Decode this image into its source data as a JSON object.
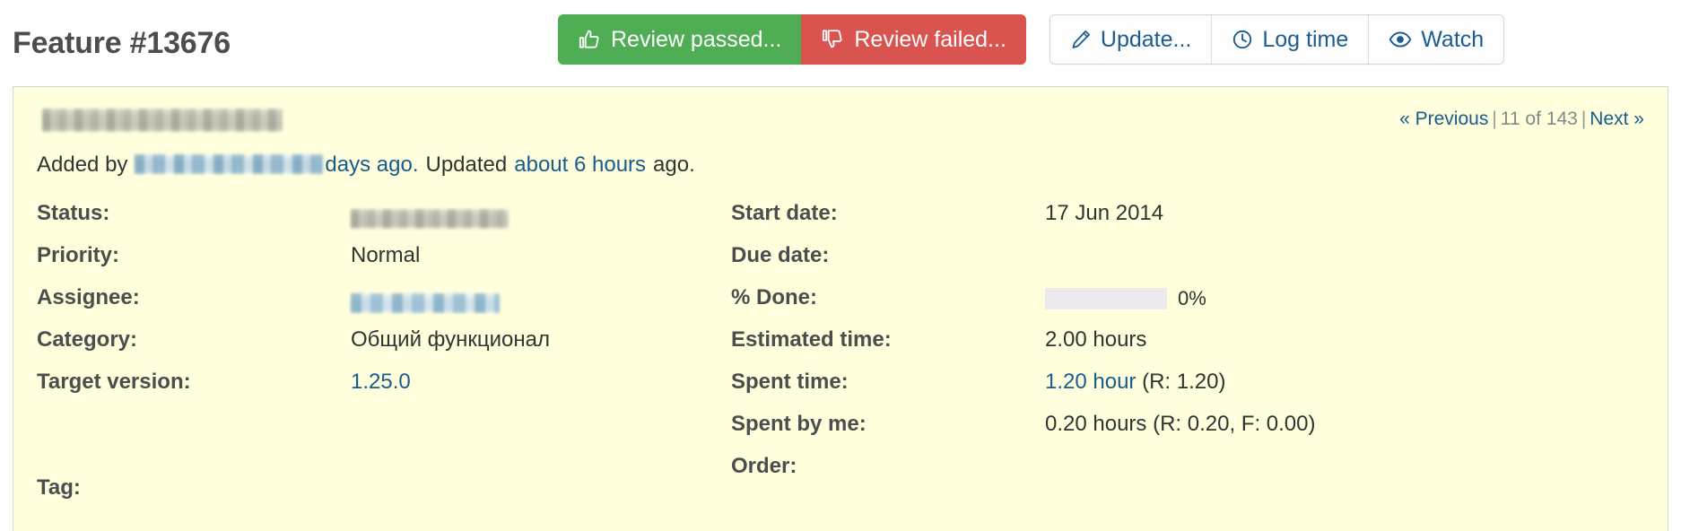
{
  "header": {
    "title": "Feature #13676",
    "buttons": [
      {
        "label": "Review passed...",
        "icon": "thumbs-up-icon",
        "style": "success",
        "color": "#4fad54"
      },
      {
        "label": "Review failed...",
        "icon": "thumbs-down-icon",
        "style": "danger",
        "color": "#d9534f"
      },
      {
        "label": "Update...",
        "icon": "pencil-icon",
        "style": "plain",
        "color": "#1c5d8f"
      },
      {
        "label": "Log time",
        "icon": "clock-icon",
        "style": "plain",
        "color": "#1c5d8f"
      },
      {
        "label": "Watch",
        "icon": "eye-icon",
        "style": "plain",
        "color": "#1c5d8f"
      }
    ]
  },
  "pager": {
    "previous": "« Previous",
    "position": "11 of 143",
    "next": "Next »",
    "separator": "|"
  },
  "issue": {
    "subject": "",
    "added_prefix": "Added by",
    "author": "",
    "added_ago": "days ago.",
    "updated_prefix": "Updated",
    "updated_ago": "about 6 hours",
    "updated_suffix": "ago."
  },
  "attributes": {
    "left": [
      {
        "label": "Status:",
        "value": "",
        "redacted": true,
        "link": false
      },
      {
        "label": "Priority:",
        "value": "Normal",
        "redacted": false,
        "link": false
      },
      {
        "label": "Assignee:",
        "value": "",
        "redacted": true,
        "link": false
      },
      {
        "label": "Category:",
        "value": "Общий функционал",
        "redacted": false,
        "link": false
      },
      {
        "label": "Target version:",
        "value": "1.25.0",
        "redacted": false,
        "link": true
      },
      {
        "label": "",
        "value": "",
        "redacted": false,
        "link": false
      },
      {
        "label": "Tag:",
        "value": "",
        "redacted": false,
        "link": false
      }
    ],
    "right": [
      {
        "label": "Start date:",
        "value": "17 Jun 2014",
        "link": false
      },
      {
        "label": "Due date:",
        "value": "",
        "link": false
      },
      {
        "label": "% Done:",
        "value": "0%",
        "progress": 0,
        "link": false
      },
      {
        "label": "Estimated time:",
        "value": "2.00 hours",
        "link": false
      },
      {
        "label": "Spent time:",
        "value": "1.20 hour",
        "value_suffix": " (R: 1.20)",
        "link": true
      },
      {
        "label": "Spent by me:",
        "value": "0.20 hours (R: 0.20, F: 0.00)",
        "link": false
      },
      {
        "label": "Order:",
        "value": "",
        "link": false
      }
    ]
  },
  "colors": {
    "panel_background": "#ffffdd",
    "panel_border": "#d7d7d7",
    "link": "#185c8d",
    "label": "#4d4d4d",
    "progress_track": "#eceaee"
  }
}
